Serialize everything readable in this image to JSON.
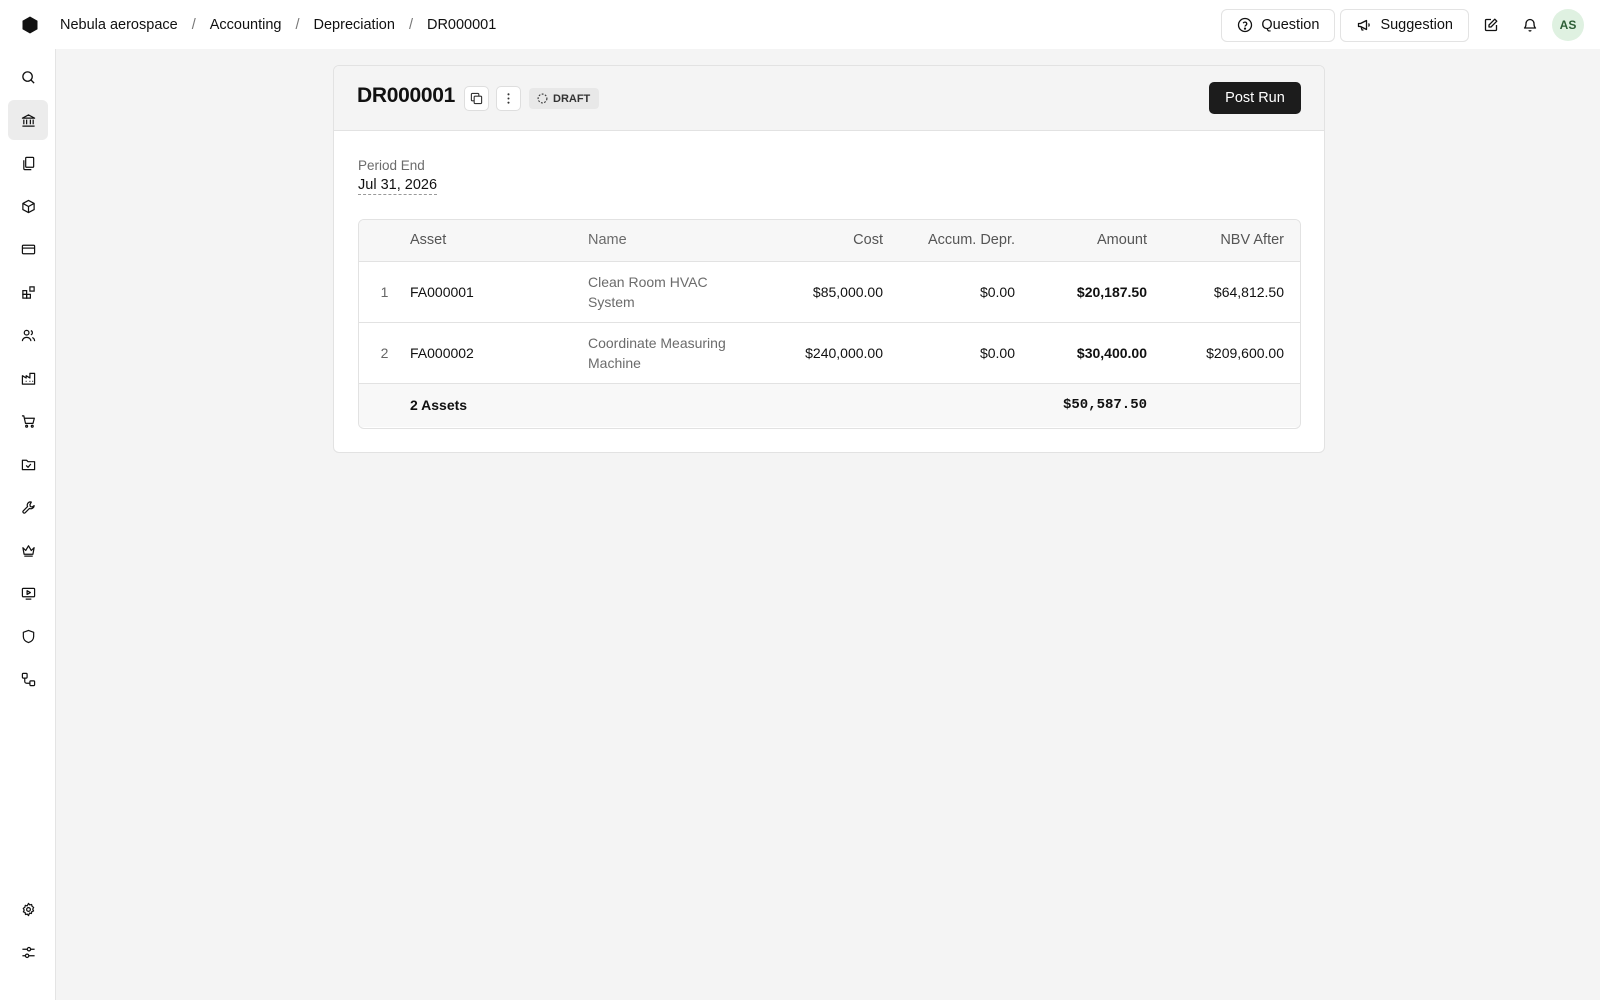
{
  "breadcrumb": {
    "company": "Nebula aerospace",
    "section": "Accounting",
    "page": "Depreciation",
    "current": "DR000001"
  },
  "topbar": {
    "question_label": "Question",
    "suggestion_label": "Suggestion",
    "avatar_initials": "AS"
  },
  "sidebar": {
    "items": [
      {
        "icon": "search-icon"
      },
      {
        "icon": "bank-icon",
        "active": true
      },
      {
        "icon": "documents-icon"
      },
      {
        "icon": "cube-icon"
      },
      {
        "icon": "credit-card-icon"
      },
      {
        "icon": "blocks-icon"
      },
      {
        "icon": "users-icon"
      },
      {
        "icon": "factory-icon"
      },
      {
        "icon": "cart-icon"
      },
      {
        "icon": "folder-check-icon"
      },
      {
        "icon": "wrench-icon"
      },
      {
        "icon": "crown-icon"
      },
      {
        "icon": "monitor-play-icon"
      },
      {
        "icon": "shield-icon"
      },
      {
        "icon": "workflow-icon"
      },
      {
        "icon": "gear-icon"
      },
      {
        "icon": "sliders-icon"
      }
    ]
  },
  "document": {
    "title": "DR000001",
    "status": "DRAFT",
    "post_label": "Post Run",
    "period_label": "Period End",
    "period_value": "Jul 31, 2026"
  },
  "table": {
    "headers": {
      "asset": "Asset",
      "name": "Name",
      "cost": "Cost",
      "accum": "Accum. Depr.",
      "amount": "Amount",
      "nbv": "NBV After"
    },
    "rows": [
      {
        "index": "1",
        "asset": "FA000001",
        "name": "Clean Room HVAC System",
        "cost": "$85,000.00",
        "accum": "$0.00",
        "amount": "$20,187.50",
        "nbv": "$64,812.50"
      },
      {
        "index": "2",
        "asset": "FA000002",
        "name": "Coordinate Measuring Machine",
        "cost": "$240,000.00",
        "accum": "$0.00",
        "amount": "$30,400.00",
        "nbv": "$209,600.00"
      }
    ],
    "footer": {
      "count_label": "2 Assets",
      "total_amount": "$50,587.50"
    }
  },
  "colors": {
    "primary_button": "#1c1c1c",
    "avatar_bg": "#dff1e1",
    "page_bg": "#f4f4f4"
  }
}
